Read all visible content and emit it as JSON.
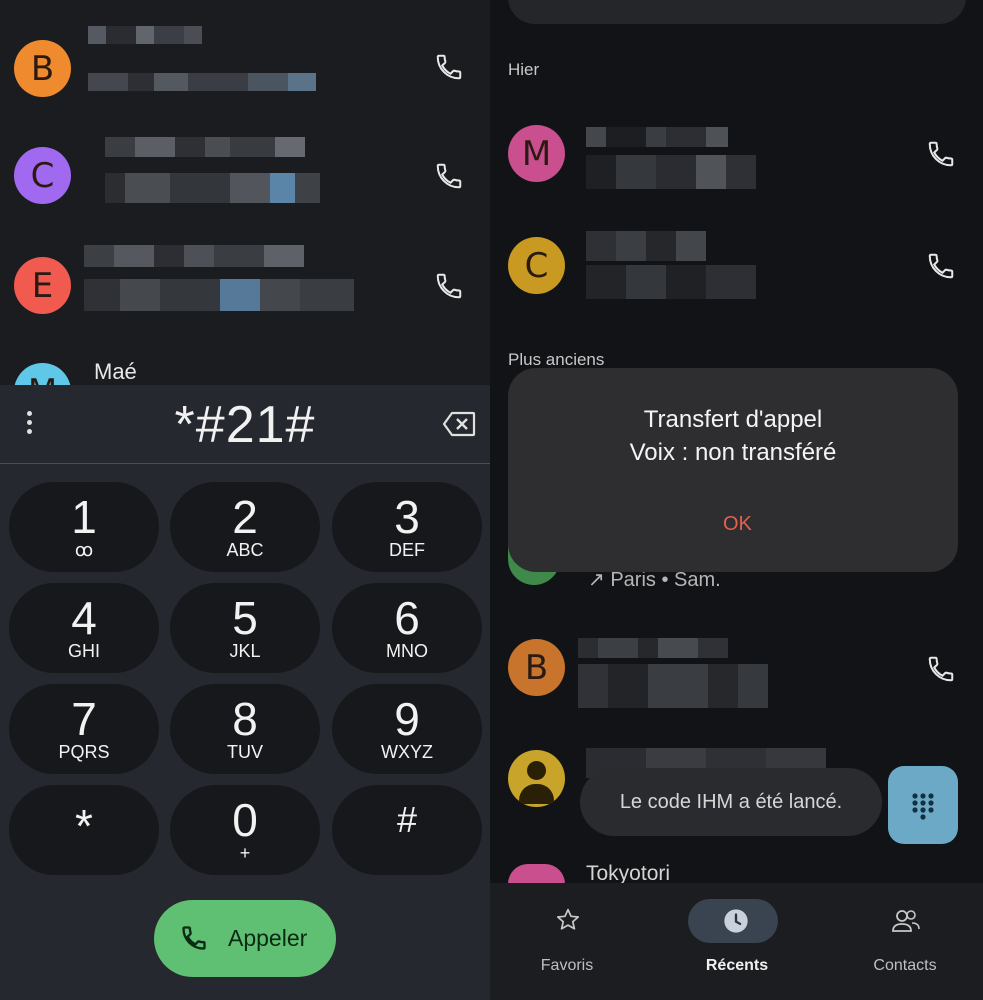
{
  "left": {
    "contacts": [
      {
        "initial": "B",
        "color": "#f08a2e"
      },
      {
        "initial": "C",
        "color": "#a069f0"
      },
      {
        "initial": "E",
        "color": "#f05a4f"
      },
      {
        "initial": "M",
        "color": "#5fc8e8",
        "name": "Maé"
      }
    ],
    "dialpad": {
      "number": "*#21#",
      "keys": [
        {
          "digit": "1",
          "letters": "ꝏ"
        },
        {
          "digit": "2",
          "letters": "ABC"
        },
        {
          "digit": "3",
          "letters": "DEF"
        },
        {
          "digit": "4",
          "letters": "GHI"
        },
        {
          "digit": "5",
          "letters": "JKL"
        },
        {
          "digit": "6",
          "letters": "MNO"
        },
        {
          "digit": "7",
          "letters": "PQRS"
        },
        {
          "digit": "8",
          "letters": "TUV"
        },
        {
          "digit": "9",
          "letters": "WXYZ"
        },
        {
          "digit": "*",
          "letters": ""
        },
        {
          "digit": "0",
          "letters": "+"
        },
        {
          "digit": "#",
          "letters": ""
        }
      ],
      "call_label": "Appeler"
    }
  },
  "right": {
    "sections": {
      "yesterday": "Hier",
      "older": "Plus anciens"
    },
    "calls": [
      {
        "initial": "M",
        "color": "#c94f8f"
      },
      {
        "initial": "C",
        "color": "#c89a22"
      },
      {
        "initial": "B",
        "color": "#c8742c"
      }
    ],
    "partial_call": {
      "detail": "↗ Paris • Sam."
    },
    "last_contact_name": "Tokyotori",
    "dialog": {
      "title": "Transfert d'appel",
      "message": "Voix : non transféré",
      "ok": "OK"
    },
    "toast": "Le code IHM a été lancé.",
    "nav": {
      "favorites": "Favoris",
      "recents": "Récents",
      "contacts": "Contacts"
    }
  }
}
